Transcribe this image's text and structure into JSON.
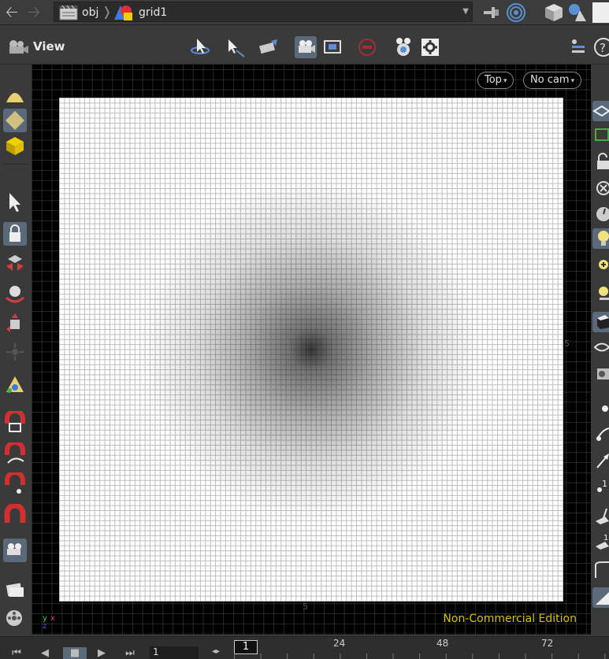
{
  "pathbar": {
    "back_icon": "left-arrow",
    "forward_icon": "right-arrow",
    "crumbs": [
      {
        "label": "obj",
        "icon": "clapboard-network-icon"
      },
      {
        "label": "grid1",
        "icon": "geometry-shapes-icon"
      }
    ],
    "dropdown_icon": "chevron-down"
  },
  "viewbar": {
    "title": "View"
  },
  "viewport": {
    "view_menu": "Top",
    "camera_menu": "No cam",
    "edition_label": "Non-Commercial Edition",
    "axis_labels": {
      "y": "y",
      "x": "x",
      "z": "z"
    },
    "tick_right": "5",
    "tick_bottom": "5"
  },
  "timeline": {
    "frame_value": "1",
    "current_frame": "1",
    "tick_labels": [
      "24",
      "48",
      "72"
    ]
  },
  "colors": {
    "edition_text": "#d6c400",
    "active_tool": "#5a6a7a",
    "background": "#3a3a3a",
    "viewport_bg": "#000000"
  }
}
